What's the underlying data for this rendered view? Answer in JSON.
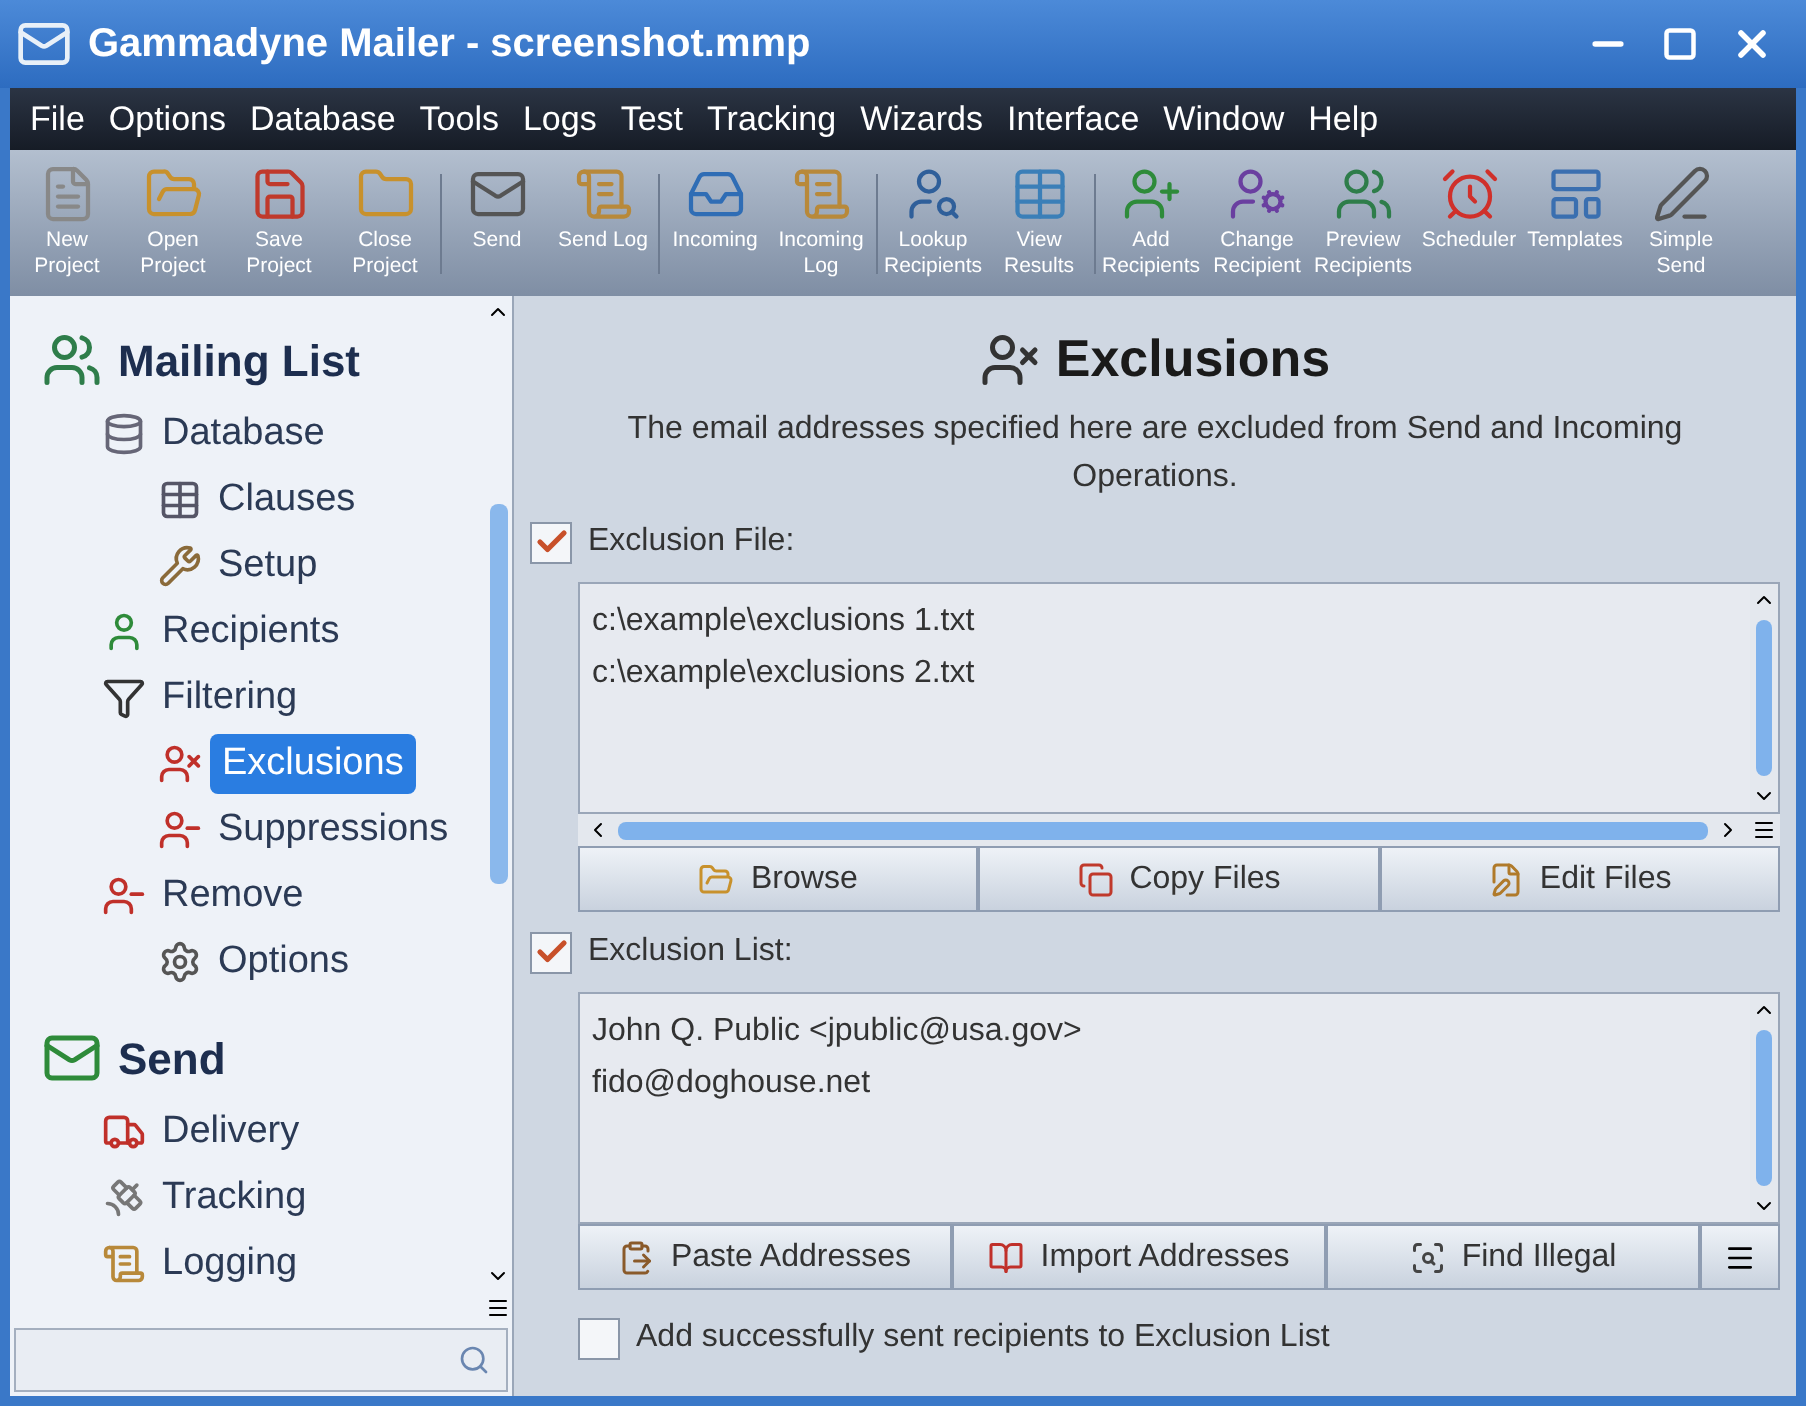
{
  "window": {
    "title": "Gammadyne Mailer - screenshot.mmp"
  },
  "menu": [
    "File",
    "Options",
    "Database",
    "Tools",
    "Logs",
    "Test",
    "Tracking",
    "Wizards",
    "Interface",
    "Window",
    "Help"
  ],
  "toolbar": [
    {
      "label": "New Project"
    },
    {
      "label": "Open Project"
    },
    {
      "label": "Save Project"
    },
    {
      "label": "Close Project"
    },
    {
      "label": "Send"
    },
    {
      "label": "Send Log"
    },
    {
      "label": "Incoming"
    },
    {
      "label": "Incoming Log"
    },
    {
      "label": "Lookup Recipients"
    },
    {
      "label": "View Results"
    },
    {
      "label": "Add Recipients"
    },
    {
      "label": "Change Recipient"
    },
    {
      "label": "Preview Recipients"
    },
    {
      "label": "Scheduler"
    },
    {
      "label": "Templates"
    },
    {
      "label": "Simple Send"
    }
  ],
  "sidebar": {
    "groups": [
      {
        "label": "Mailing List",
        "children": [
          {
            "label": "Database",
            "selected": false,
            "children": [
              {
                "label": "Clauses",
                "selected": false
              },
              {
                "label": "Setup",
                "selected": false
              }
            ]
          },
          {
            "label": "Recipients",
            "selected": false
          },
          {
            "label": "Filtering",
            "selected": false,
            "children": [
              {
                "label": "Exclusions",
                "selected": true
              },
              {
                "label": "Suppressions",
                "selected": false
              }
            ]
          },
          {
            "label": "Remove",
            "selected": false,
            "children": [
              {
                "label": "Options",
                "selected": false
              }
            ]
          }
        ]
      },
      {
        "label": "Send",
        "children": [
          {
            "label": "Delivery",
            "selected": false
          },
          {
            "label": "Tracking",
            "selected": false
          },
          {
            "label": "Logging",
            "selected": false
          }
        ]
      }
    ]
  },
  "main": {
    "title": "Exclusions",
    "description": "The email addresses specified here are excluded from Send and Incoming Operations.",
    "exclusion_file": {
      "label": "Exclusion File:",
      "checked": true,
      "lines": [
        "c:\\example\\exclusions 1.txt",
        "c:\\example\\exclusions 2.txt"
      ],
      "buttons": [
        "Browse",
        "Copy Files",
        "Edit Files"
      ]
    },
    "exclusion_list": {
      "label": "Exclusion List:",
      "checked": true,
      "lines": [
        "John Q. Public <jpublic@usa.gov>",
        "fido@doghouse.net"
      ],
      "buttons": [
        "Paste Addresses",
        "Import Addresses",
        "Find Illegal"
      ]
    },
    "add_sent": {
      "label": "Add successfully sent recipients to Exclusion List",
      "checked": false
    }
  }
}
